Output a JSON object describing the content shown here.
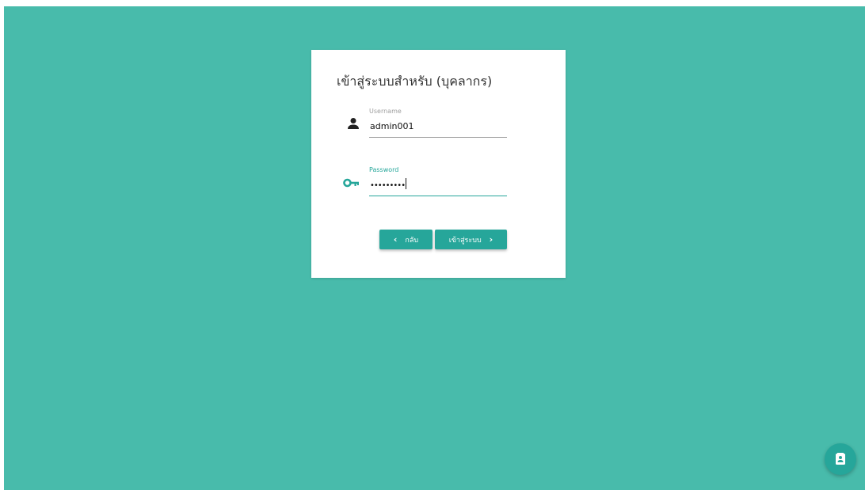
{
  "login": {
    "title": "เข้าสู่ระบบสำหรับ (บุคลากร)",
    "username": {
      "label": "Username",
      "value": "admin001",
      "icon": "person-icon"
    },
    "password": {
      "label": "Password",
      "value": "•••••••••",
      "icon": "key-icon"
    },
    "buttons": {
      "back_label": "กลับ",
      "login_label": "เข้าสู่ระบบ"
    }
  },
  "fab": {
    "icon": "contact-card-icon"
  },
  "colors": {
    "background": "#48bbab",
    "accent": "#26a69a",
    "card": "#ffffff"
  }
}
